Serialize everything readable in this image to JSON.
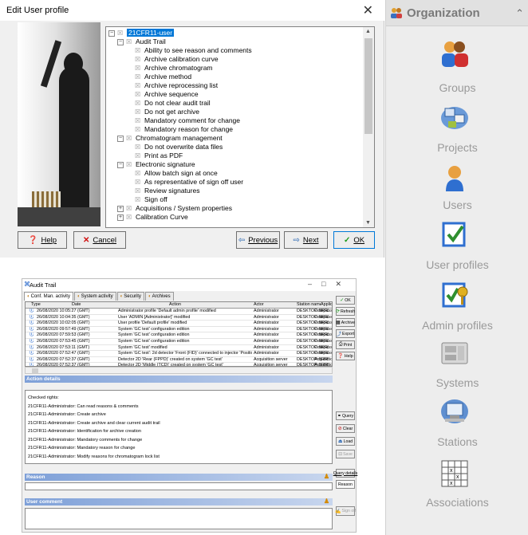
{
  "edit_dialog": {
    "title": "Edit User profile",
    "tree": [
      {
        "label": "21CFR11-user",
        "level": 0,
        "toggle": "⊟",
        "selected": true
      },
      {
        "label": "Audit Trail",
        "level": 1,
        "toggle": "⊟"
      },
      {
        "label": "Ability to see reason and comments",
        "level": 2
      },
      {
        "label": "Archive calibration curve",
        "level": 2
      },
      {
        "label": "Archive chromatogram",
        "level": 2
      },
      {
        "label": "Archive method",
        "level": 2
      },
      {
        "label": "Archive reprocessing list",
        "level": 2
      },
      {
        "label": "Archive sequence",
        "level": 2
      },
      {
        "label": "Do not clear audit trail",
        "level": 2
      },
      {
        "label": "Do not get archive",
        "level": 2
      },
      {
        "label": "Mandatory comment for change",
        "level": 2
      },
      {
        "label": "Mandatory reason for change",
        "level": 2
      },
      {
        "label": "Chromatogram management",
        "level": 1,
        "toggle": "⊟"
      },
      {
        "label": "Do not overwrite data files",
        "level": 2
      },
      {
        "label": "Print as PDF",
        "level": 2
      },
      {
        "label": "Electronic signature",
        "level": 1,
        "toggle": "⊟"
      },
      {
        "label": "Allow batch sign at once",
        "level": 2
      },
      {
        "label": "As representative of sign off user",
        "level": 2
      },
      {
        "label": "Review signatures",
        "level": 2
      },
      {
        "label": "Sign off",
        "level": 2
      },
      {
        "label": "Acquisitions / System properties",
        "level": 1,
        "toggle": "⊞"
      },
      {
        "label": "Calibration Curve",
        "level": 1,
        "toggle": "⊞"
      }
    ],
    "buttons": {
      "help": "Help",
      "cancel": "Cancel",
      "previous": "Previous",
      "next": "Next",
      "ok": "OK"
    }
  },
  "organization": {
    "title": "Organization",
    "items": [
      {
        "label": "Groups",
        "icon": "groups-icon"
      },
      {
        "label": "Projects",
        "icon": "projects-icon"
      },
      {
        "label": "Users",
        "icon": "users-icon"
      },
      {
        "label": "User profiles",
        "icon": "user-profiles-icon"
      },
      {
        "label": "Admin profiles",
        "icon": "admin-profiles-icon"
      },
      {
        "label": "Systems",
        "icon": "systems-icon"
      },
      {
        "label": "Stations",
        "icon": "stations-icon"
      },
      {
        "label": "Associations",
        "icon": "associations-icon"
      }
    ]
  },
  "audit_trail": {
    "title": "Audit Trail",
    "tabs": [
      "Conf. Man. activity",
      "System activity",
      "Security",
      "Archives"
    ],
    "columns": [
      "Type",
      "Date",
      "Action",
      "Actor",
      "Station name",
      "Applicatio"
    ],
    "rows": [
      {
        "date": "26/08/2020 10:05:27 (GMT)",
        "action": "Administrator profile 'Default admin profile' modified",
        "actor": "Administrator",
        "station": "DESKTOP-SRRS2BQ",
        "app": "Compass"
      },
      {
        "date": "26/08/2020 10:04:35 (GMT)",
        "action": "User 'ADMIN [Administrator]' modified",
        "actor": "Administrator",
        "station": "DESKTOP-SRRS2BQ",
        "app": "Compass"
      },
      {
        "date": "26/08/2020 10:02:05 (GMT)",
        "action": "User profile 'Default profile' modified",
        "actor": "Administrator",
        "station": "DESKTOP-SRRS2BQ",
        "app": "Compass"
      },
      {
        "date": "26/08/2020 09:57:49 (GMT)",
        "action": "System 'GC test' configuration edition",
        "actor": "Administrator",
        "station": "DESKTOP-SRRS2BQ",
        "app": "Compass"
      },
      {
        "date": "26/08/2020 07:59:53 (GMT)",
        "action": "System 'GC test' configuration edition",
        "actor": "Administrator",
        "station": "DESKTOP-SRRS2BQ",
        "app": "Compass"
      },
      {
        "date": "26/08/2020 07:53:45 (GMT)",
        "action": "System 'GC test' configuration edition",
        "actor": "Administrator",
        "station": "DESKTOP-SRRS2BQ",
        "app": "Compass"
      },
      {
        "date": "26/08/2020 07:53:11 (GMT)",
        "action": "System 'GC test' modified",
        "actor": "Administrator",
        "station": "DESKTOP-SRRS2BQ",
        "app": "Compass"
      },
      {
        "date": "26/08/2020 07:52:47 (GMT)",
        "action": "System 'GC test': 2d detector 'Front (FID)' connected to injector 'Positio",
        "actor": "Administrator",
        "station": "DESKTOP-SRRS2BQ",
        "app": "Compass"
      },
      {
        "date": "26/08/2020 07:52:37 (GMT)",
        "action": "Detector 2D 'Rear (FPPD)' created on system 'GC test'",
        "actor": "Acquisition server",
        "station": "DESKTOP-SRRS2BQ",
        "app": "Acquisitio"
      },
      {
        "date": "26/08/2020 07:52:37 (GMT)",
        "action": "Detector 2D 'Middle (TCD)' created on system 'GC test'",
        "actor": "Acquisition server",
        "station": "DESKTOP-SRRS2BQ",
        "app": "Acquisitio"
      },
      {
        "date": "26/08/2020 07:52:37 (GMT)",
        "action": "Detector 2D 'Front (FID)' created on system 'GC test'",
        "actor": "Acquisition server",
        "station": "DESKTOP-SRRS2BQ",
        "app": "Acquisitio"
      },
      {
        "date": "26/08/2020 07:52:37 (GMT)",
        "action": "Injector 'Position 2' created on system 'GC test'",
        "actor": "Acquisition server",
        "station": "DESKTOP-SRRS2BQ",
        "app": "Acquisitio"
      }
    ],
    "details_title": "Action details",
    "details_lines": [
      "Checked rights:",
      "21CFR11-Administrator: Can read reasons & comments",
      "21CFR11-Administrator: Create archive",
      "21CFR11-Administrator: Create archive and clear current audit trail",
      "21CFR11-Administrator: Identification for archive creation",
      "21CFR11-Administrator: Mandatory comments for change",
      "21CFR11-Administrator: Mandatory reason for change",
      "21CFR11-Administrator: Modify reasons for chromatogram lock list"
    ],
    "reason_title": "Reason",
    "comment_title": "User comment",
    "buttons": {
      "ok": "OK",
      "refresh": "Refresh",
      "archive": "Archive",
      "export": "Export",
      "print": "Print",
      "help": "Help",
      "query": "Query",
      "clear": "Clear",
      "load": "Load",
      "save": "Save",
      "query_details": "Query details",
      "reason": "Reason",
      "sign_off": "Sign off"
    }
  }
}
